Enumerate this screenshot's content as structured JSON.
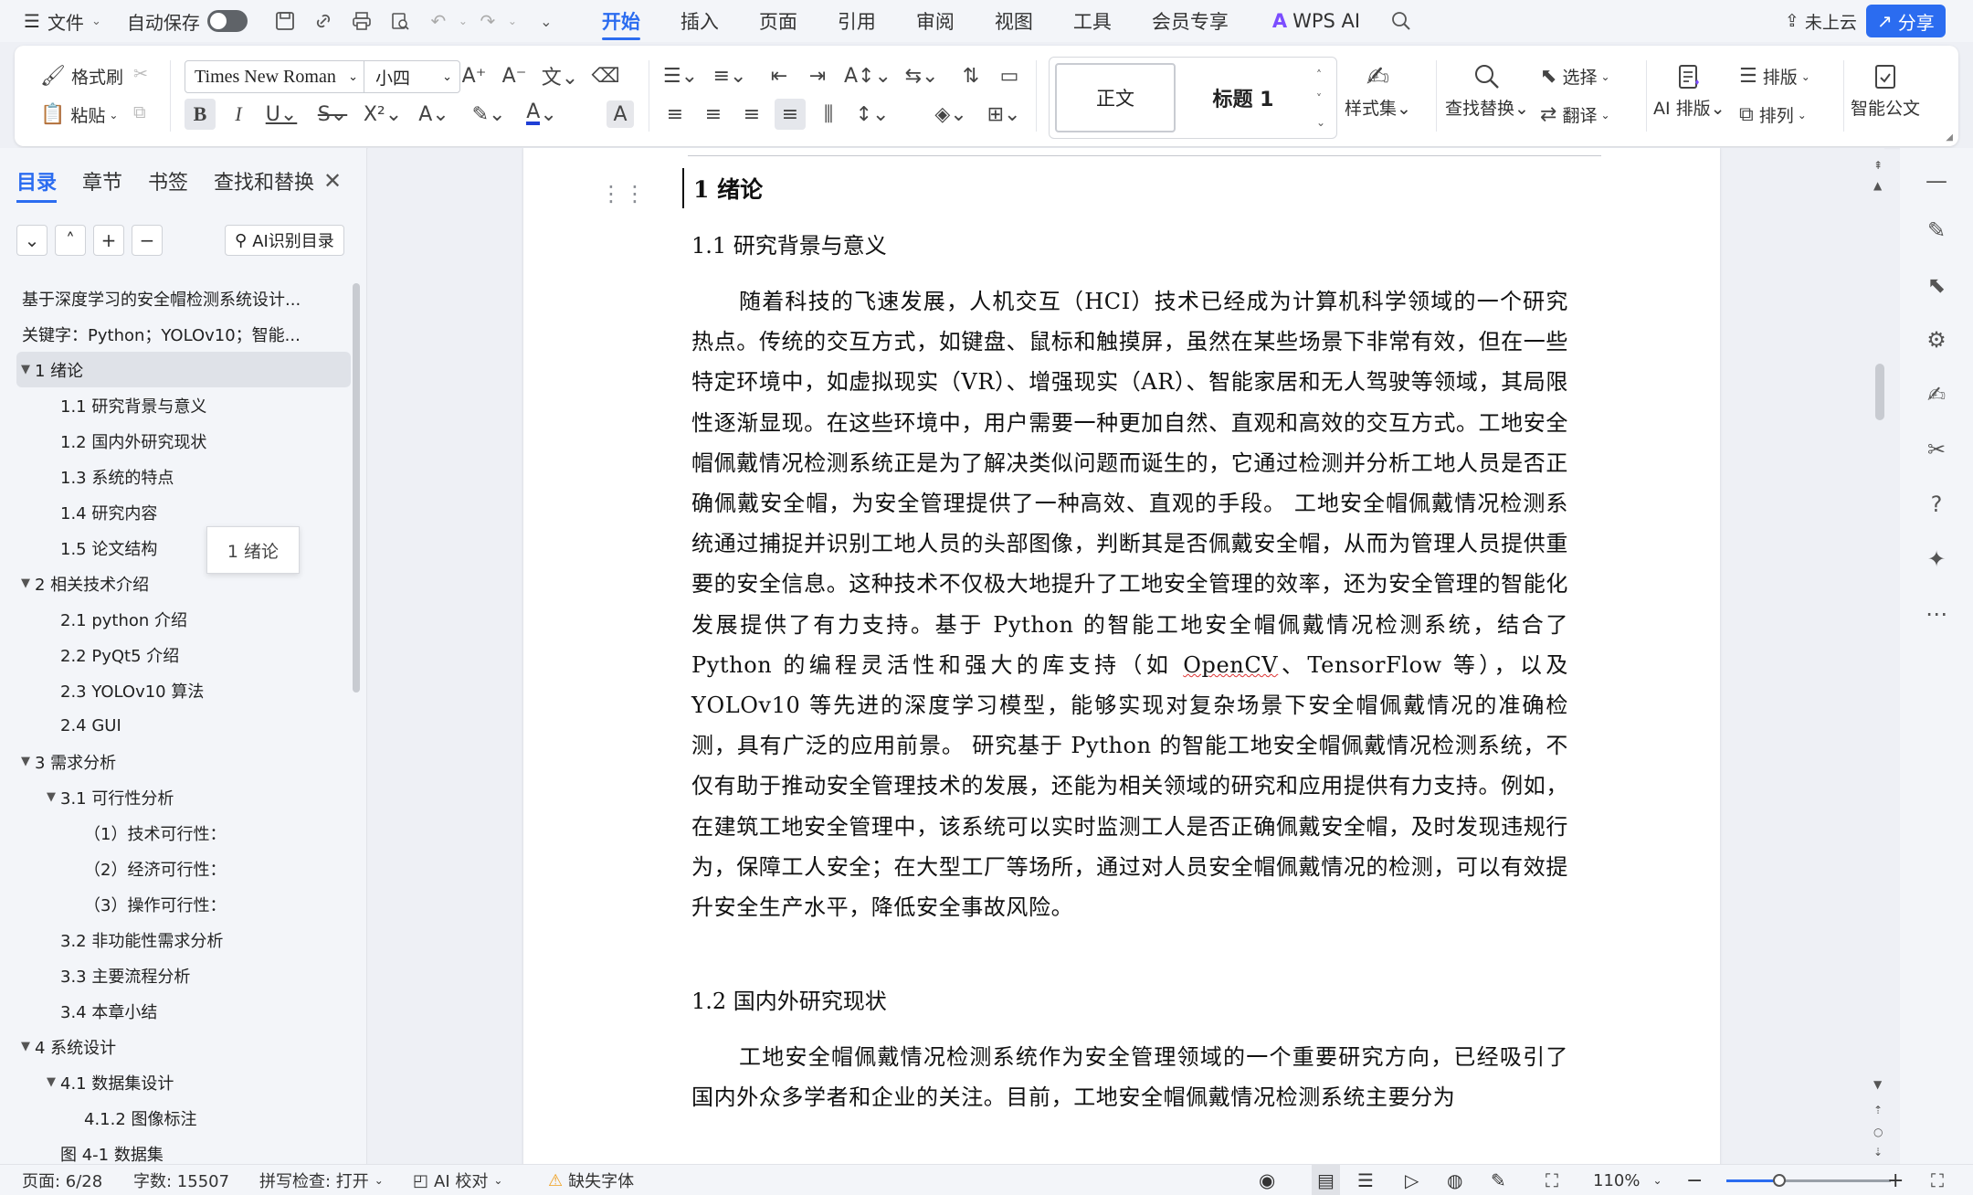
{
  "menubar": {
    "file_label": "文件",
    "autosave_label": "自动保存",
    "tabs": [
      "开始",
      "插入",
      "页面",
      "引用",
      "审阅",
      "视图",
      "工具",
      "会员专享"
    ],
    "active_tab": "开始",
    "wps_ai_label": "WPS AI",
    "cloud_label": "未上云",
    "share_label": "分享"
  },
  "ribbon": {
    "format_painter": "格式刷",
    "paste": "粘贴",
    "font_name": "Times New Roman",
    "font_size": "小四",
    "style_normal": "正文",
    "style_heading": "标题 1",
    "style_set": "样式集",
    "find_replace": "查找替换",
    "select": "选择",
    "translate": "翻译",
    "ai_layout": "AI 排版",
    "layout": "排版",
    "arrange": "排列",
    "smart_doc": "智能公文"
  },
  "nav": {
    "tabs": [
      "目录",
      "章节",
      "书签",
      "查找和替换"
    ],
    "active_tab": "目录",
    "ai_toc_label": "AI识别目录",
    "tooltip": "1 绪论",
    "items": [
      {
        "text": "基于深度学习的安全帽检测系统设计...",
        "level": 0,
        "caret": ""
      },
      {
        "text": "关键字：Python；YOLOv10；智能...",
        "level": 0,
        "caret": ""
      },
      {
        "text": "1  绪论",
        "level": 0,
        "caret": "▼",
        "selected": true
      },
      {
        "text": "1.1 研究背景与意义",
        "level": 1,
        "caret": ""
      },
      {
        "text": "1.2 国内外研究现状",
        "level": 1,
        "caret": ""
      },
      {
        "text": "1.3 系统的特点",
        "level": 1,
        "caret": ""
      },
      {
        "text": "1.4 研究内容",
        "level": 1,
        "caret": ""
      },
      {
        "text": "1.5 论文结构",
        "level": 1,
        "caret": ""
      },
      {
        "text": "2  相关技术介绍",
        "level": 0,
        "caret": "▼"
      },
      {
        "text": "2.1 python 介绍",
        "level": 1,
        "caret": ""
      },
      {
        "text": "2.2 PyQt5 介绍",
        "level": 1,
        "caret": ""
      },
      {
        "text": "2.3 YOLOv10 算法",
        "level": 1,
        "caret": ""
      },
      {
        "text": "2.4 GUI",
        "level": 1,
        "caret": ""
      },
      {
        "text": "3  需求分析",
        "level": 0,
        "caret": "▼"
      },
      {
        "text": "3.1 可行性分析",
        "level": 1,
        "caret": "▼"
      },
      {
        "text": "（1）技术可行性：",
        "level": 2,
        "caret": ""
      },
      {
        "text": "（2）经济可行性：",
        "level": 2,
        "caret": ""
      },
      {
        "text": "（3）操作可行性：",
        "level": 2,
        "caret": ""
      },
      {
        "text": "3.2  非功能性需求分析",
        "level": 1,
        "caret": ""
      },
      {
        "text": "3.3 主要流程分析",
        "level": 1,
        "caret": ""
      },
      {
        "text": "3.4 本章小结",
        "level": 1,
        "caret": ""
      },
      {
        "text": "4  系统设计",
        "level": 0,
        "caret": "▼"
      },
      {
        "text": "4.1  数据集设计",
        "level": 1,
        "caret": "▼"
      },
      {
        "text": "4.1.2 图像标注",
        "level": 2,
        "caret": ""
      },
      {
        "text": "图 4-1  数据集",
        "level": 1,
        "caret": ""
      }
    ]
  },
  "document": {
    "h1": "1  绪论",
    "h2_a": "1.1 研究背景与意义",
    "para_1a": "随着科技的飞速发展，人机交互（HCI）技术已经成为计算机科学领域的一个研究热点。传统的交互方式，如键盘、鼠标和触摸屏，虽然在某些场景下非常有效，但在一些特定环境中，如虚拟现实（VR）、增强现实（AR）、智能家居和无人驾驶等领域，其局限性逐渐显现。在这些环境中，用户需要一种更加自然、直观和高效的交互方式。工地安全帽佩戴情况检测系统正是为了解决类似问题而诞生的，它通过检测并分析工地人员是否正确佩戴安全帽，为安全管理提供了一种高效、直观的手段。 工地安全帽佩戴情况检测系统通过捕捉并识别工地人员的头部图像，判断其是否佩戴安全帽，从而为管理人员提供重要的安全信息。这种技术不仅极大地提升了工地安全管理的效率，还为安全管理的智能化发展提供了有力支持。基于 Python 的智能工地安全帽佩戴情况检测系统，结合了 Python 的编程灵活性和强大的库支持（如 ",
    "para_1_spell": "OpenCV",
    "para_1b": "、TensorFlow 等），以及 YOLOv10 等先进的深度学习模型，能够实现对复杂场景下安全帽佩戴情况的准确检测，具有广泛的应用前景。 研究基于 Python 的智能工地安全帽佩戴情况检测系统，不仅有助于推动安全管理技术的发展，还能为相关领域的研究和应用提供有力支持。例如，在建筑工地安全管理中，该系统可以实时监测工人是否正确佩戴安全帽，及时发现违规行为，保障工人安全；在大型工厂等场所，通过对人员安全帽佩戴情况的检测，可以有效提升安全生产水平，降低安全事故风险。",
    "h2_b": "1.2 国内外研究现状",
    "para_2": "工地安全帽佩戴情况检测系统作为安全管理领域的一个重要研究方向，已经吸引了国内外众多学者和企业的关注。目前，工地安全帽佩戴情况检测系统主要分为"
  },
  "statusbar": {
    "page": "页面: 6/28",
    "words": "字数: 15507",
    "spellcheck": "拼写检查: 打开",
    "ai_check": "AI 校对",
    "missing_font": "缺失字体",
    "zoom": "110%",
    "zoom_fraction": 0.32
  }
}
